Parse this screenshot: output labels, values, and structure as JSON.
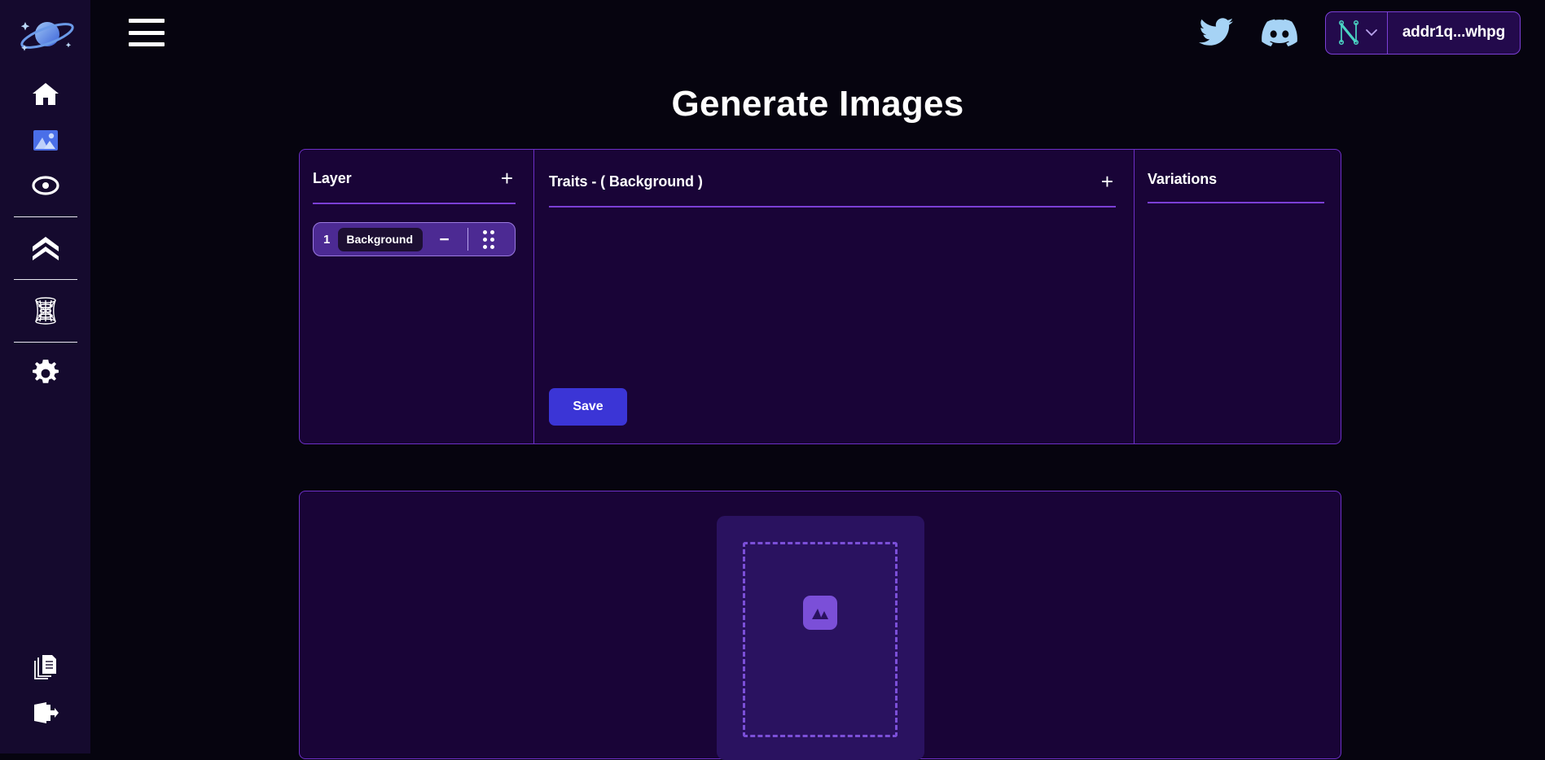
{
  "app": {
    "logo_name": "planet-logo",
    "background_color": "#06040f",
    "panel_color": "#190437",
    "accent_color": "#7b3fd6",
    "save_color": "#3b35d6"
  },
  "sidebar": {
    "items": [
      {
        "icon": "home-icon",
        "name": "sidebar-item-home",
        "active": false
      },
      {
        "icon": "image-icon",
        "name": "sidebar-item-images",
        "active": true
      },
      {
        "icon": "eye-target-icon",
        "name": "sidebar-item-explore",
        "active": false
      },
      {
        "icon": "chevrons-up-icon",
        "name": "sidebar-item-upgrade",
        "active": false
      },
      {
        "icon": "hyperboloid-icon",
        "name": "sidebar-item-mesh",
        "active": false
      },
      {
        "icon": "gear-icon",
        "name": "sidebar-item-settings",
        "active": false
      }
    ],
    "bottom_items": [
      {
        "icon": "documents-icon",
        "name": "sidebar-item-documents"
      },
      {
        "icon": "logout-icon",
        "name": "sidebar-item-logout"
      }
    ]
  },
  "header": {
    "menu_icon": "hamburger-icon",
    "twitter_icon": "twitter-icon",
    "discord_icon": "discord-icon",
    "wallet": {
      "provider_icon": "nami-wallet-icon",
      "chevron_icon": "chevron-down-icon",
      "address": "addr1q...whpg"
    }
  },
  "main": {
    "title": "Generate Images",
    "layer_panel": {
      "heading": "Layer",
      "add_label": "+",
      "rows": [
        {
          "index": "1",
          "name_value": "Background",
          "name_placeholder": "Layer name",
          "remove_label": "−",
          "drag_handle": "drag-handle-icon"
        }
      ]
    },
    "traits_panel": {
      "heading": "Traits - ( Background )",
      "add_label": "+",
      "items": [],
      "save_label": "Save"
    },
    "variations_panel": {
      "heading": "Variations",
      "items": []
    },
    "upload_panel": {
      "dropzone_icon": "image-placeholder-icon",
      "dropzone_label": ""
    }
  }
}
